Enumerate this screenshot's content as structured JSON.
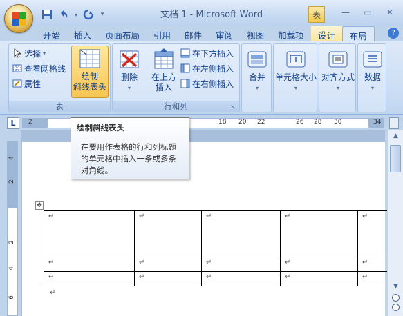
{
  "titlebar": {
    "doc_title": "文档 1 - Microsoft Word",
    "context_label": "表",
    "minimize": "—",
    "maximize": "▭",
    "close": "✕"
  },
  "tabs": [
    {
      "label": "开始"
    },
    {
      "label": "插入"
    },
    {
      "label": "页面布局"
    },
    {
      "label": "引用"
    },
    {
      "label": "邮件"
    },
    {
      "label": "审阅"
    },
    {
      "label": "视图"
    },
    {
      "label": "加载项"
    },
    {
      "label": "设计"
    },
    {
      "label": "布局"
    }
  ],
  "ribbon": {
    "table_group": {
      "label": "表",
      "select": "选择",
      "gridlines": "查看网格线",
      "properties": "属性",
      "draw_diagonal_line1": "绘制",
      "draw_diagonal_line2": "斜线表头"
    },
    "rows_cols_group": {
      "label": "行和列",
      "delete": "删除",
      "insert_above_line1": "在上方",
      "insert_above_line2": "插入",
      "insert_below": "在下方插入",
      "insert_left": "在左侧插入",
      "insert_right": "在右侧插入"
    },
    "merge": "合并",
    "cell_size": "单元格大小",
    "alignment": "对齐方式",
    "data": "数据"
  },
  "ruler": {
    "tab_selector": "L",
    "numbers": [
      "2",
      "18",
      "20",
      "22",
      "26",
      "28",
      "30",
      "34"
    ]
  },
  "vruler_numbers": [
    "4",
    "2",
    "2",
    "4",
    "6"
  ],
  "tooltip": {
    "title": "绘制斜线表头",
    "body": "在要用作表格的行和列标题的单元格中插入一条或多条对角线。"
  },
  "table_cell_mark": "↵",
  "paragraph_mark": "↵"
}
